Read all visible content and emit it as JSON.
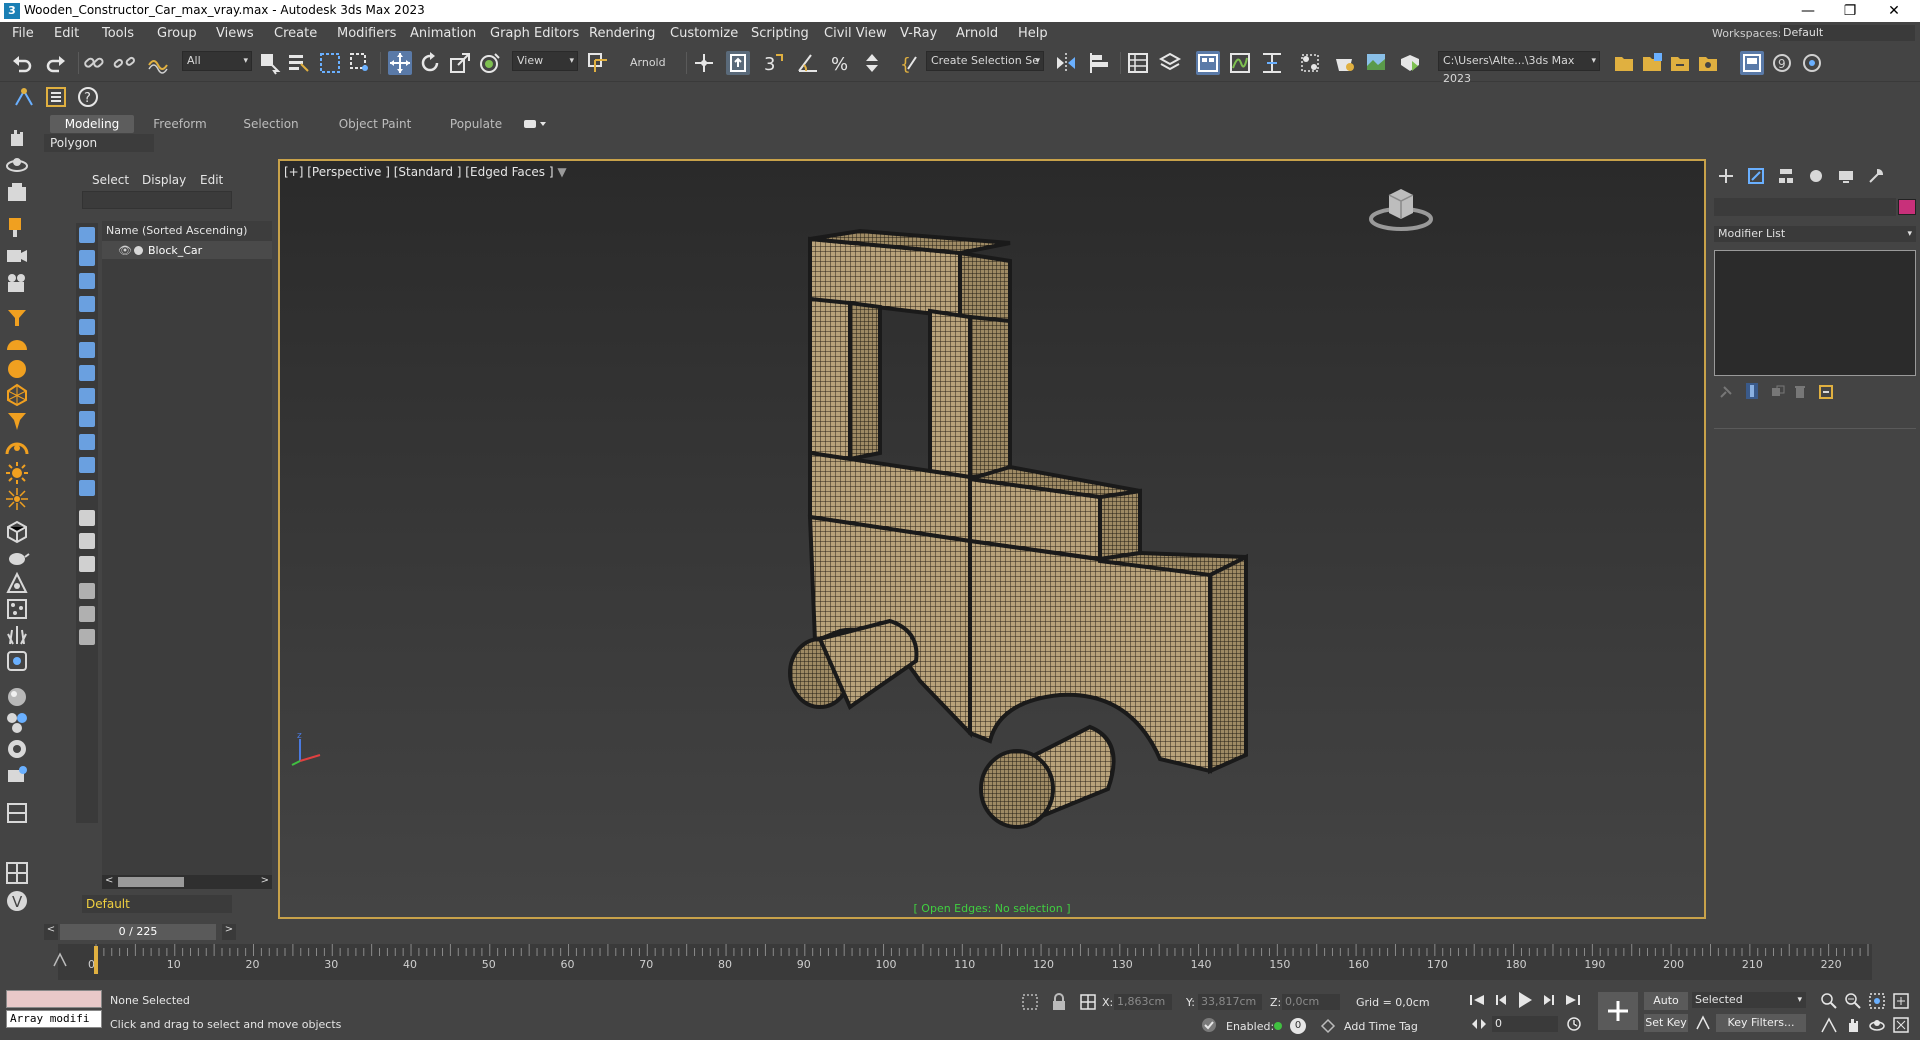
{
  "window": {
    "app_icon": "3",
    "title": "Wooden_Constructor_Car_max_vray.max - Autodesk 3ds Max 2023",
    "minimize": "—",
    "restore": "❐",
    "close": "✕"
  },
  "menu": {
    "items": [
      "File",
      "Edit",
      "Tools",
      "Group",
      "Views",
      "Create",
      "Modifiers",
      "Animation",
      "Graph Editors",
      "Rendering",
      "Customize",
      "Scripting",
      "Civil View",
      "V-Ray",
      "Arnold",
      "Help"
    ],
    "workspaces_label": "Workspaces:",
    "workspaces_value": "Default"
  },
  "toolbar": {
    "selection_filter": "All",
    "ref_coord": "View",
    "arnold_label": "Arnold",
    "named_selection": "Create Selection Se",
    "project_path": "C:\\Users\\Alte...\\3ds Max 2023",
    "dropdown_arrow": "▾"
  },
  "ribbon": {
    "tabs": [
      "Modeling",
      "Freeform",
      "Selection",
      "Object Paint",
      "Populate"
    ],
    "active_tab": "Modeling",
    "panel_label": "Polygon Modeling"
  },
  "explorer": {
    "tabs": [
      "Select",
      "Display",
      "Edit"
    ],
    "column_header": "Name (Sorted Ascending)",
    "object_name": "Block_Car",
    "eye_glyph": "👁",
    "layer": "Default",
    "scroll_left": "<",
    "scroll_right": ">"
  },
  "viewport": {
    "label": "[+] [Perspective ] [Standard ] [Edged Faces ]",
    "status": "[ Open Edges: No selection ]",
    "axis_z": "z",
    "axis_x": "x",
    "axis_y": "y"
  },
  "command_panel": {
    "modifier_list": "Modifier List"
  },
  "timeline": {
    "frame_display": "0 / 225",
    "prev": "<",
    "next": ">",
    "tick_labels": [
      "0",
      "10",
      "20",
      "30",
      "40",
      "50",
      "60",
      "70",
      "80",
      "90",
      "100",
      "110",
      "120",
      "130",
      "140",
      "150",
      "160",
      "170",
      "180",
      "190",
      "200",
      "210",
      "220"
    ]
  },
  "status": {
    "maxscript_text": "Array modifi",
    "selection": "None Selected",
    "prompt": "Click and drag to select and move objects",
    "x_label": "X:",
    "x_value": "1,863cm",
    "y_label": "Y:",
    "y_value": "33,817cm",
    "z_label": "Z:",
    "z_value": "0,0cm",
    "grid": "Grid = 0,0cm",
    "enabled_label": "Enabled:",
    "enabled_count": "0",
    "add_time_tag": "Add Time Tag",
    "auto_key": "Auto Key",
    "set_key": "Set Key",
    "key_mode": "Selected",
    "key_filters": "Key Filters...",
    "current_frame": "0"
  },
  "colors": {
    "viewport_border": "#c8a24a",
    "wood_mesh": "#b8a27a",
    "status_green": "#40d040",
    "object_color": "#c8307a"
  }
}
